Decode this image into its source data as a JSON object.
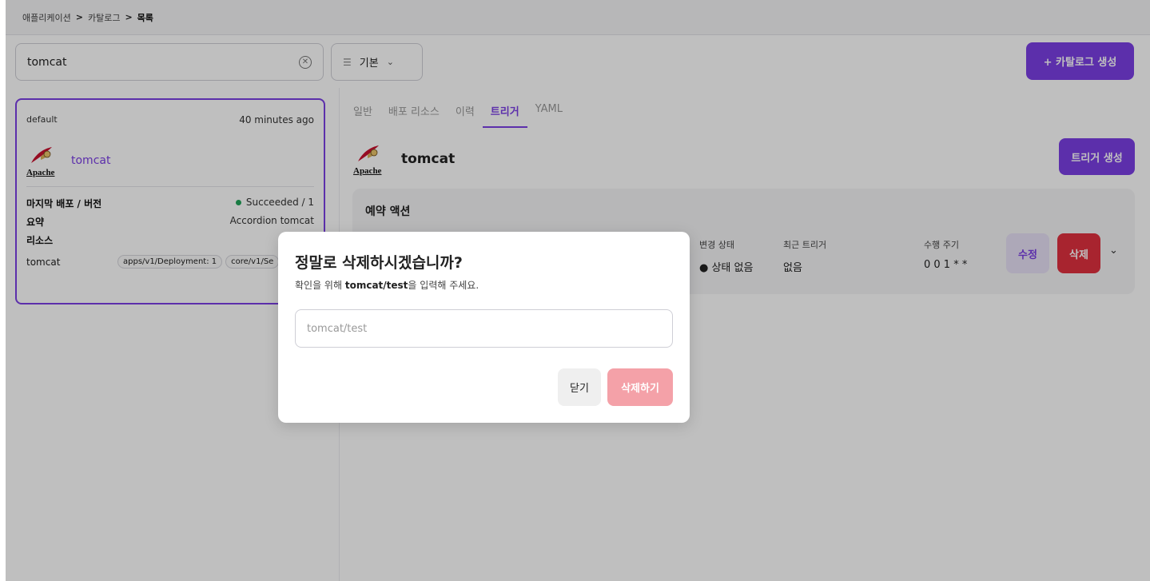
{
  "breadcrumb": {
    "items": [
      "애플리케이션",
      "카탈로그",
      "목록"
    ],
    "separator": ">"
  },
  "search": {
    "value": "tomcat"
  },
  "filter": {
    "label": "기본"
  },
  "create_catalog_button": "+ 카탈로그 생성",
  "card": {
    "namespace": "default",
    "time": "40 minutes ago",
    "name": "tomcat",
    "logo_text": "Apache",
    "last_deploy_label": "마지막 배포 / 버전",
    "last_deploy_value": "Succeeded / 1",
    "summary_label": "요약",
    "summary_value": "Accordion tomcat",
    "resources_label": "리소스",
    "resource_name": "tomcat",
    "resource_tags": [
      "apps/v1/Deployment: 1",
      "core/v1/Se"
    ]
  },
  "tabs": [
    "일반",
    "배포 리소스",
    "이력",
    "트리거",
    "YAML"
  ],
  "active_tab": "트리거",
  "detail": {
    "title": "tomcat",
    "create_trigger_button": "트리거 생성",
    "section_title": "예약 액션",
    "columns": [
      {
        "label": "변경 상태",
        "value": "● 상태 없음"
      },
      {
        "label": "최근 트리거",
        "value": "없음"
      },
      {
        "label": "수행 주기",
        "value": "0 0 1 * *"
      }
    ],
    "edit_button": "수정",
    "delete_button": "삭제"
  },
  "modal": {
    "title": "정말로 삭제하시겠습니까?",
    "desc_prefix": "확인을 위해 ",
    "desc_strong": "tomcat/test",
    "desc_suffix": "을 입력해 주세요.",
    "input_placeholder": "tomcat/test",
    "close_button": "닫기",
    "confirm_button": "삭제하기"
  },
  "colors": {
    "accent": "#7b3fe4",
    "danger": "#e0303f",
    "success": "#22a55a"
  }
}
